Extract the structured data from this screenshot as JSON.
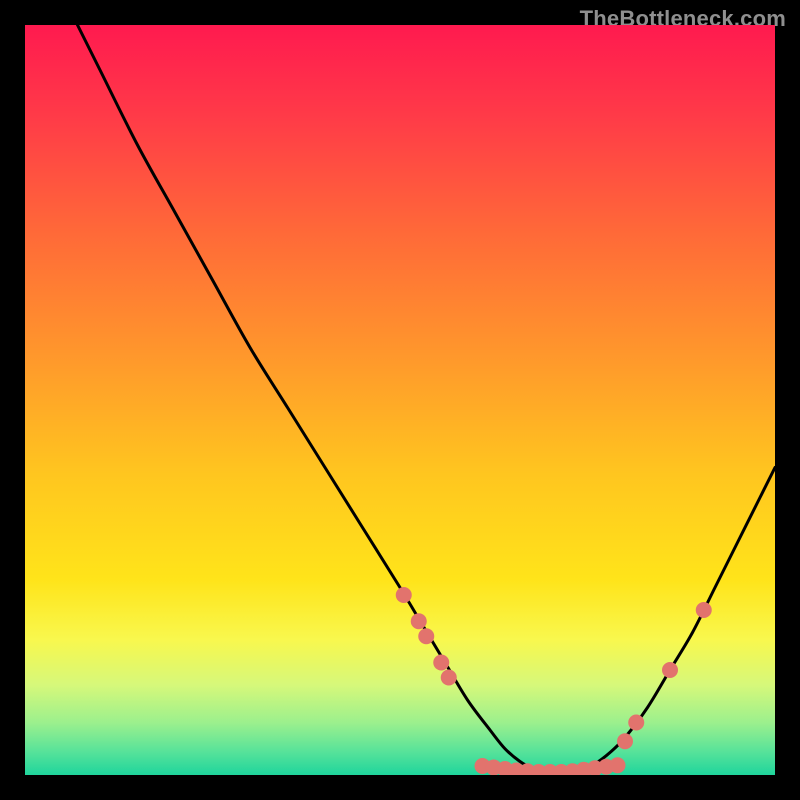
{
  "watermark": "TheBottleneck.com",
  "chart_data": {
    "type": "line",
    "title": "",
    "xlabel": "",
    "ylabel": "",
    "xlim": [
      0,
      100
    ],
    "ylim": [
      0,
      100
    ],
    "series": [
      {
        "name": "bottleneck-curve",
        "color": "#000000",
        "x": [
          7,
          10,
          15,
          20,
          25,
          30,
          35,
          40,
          45,
          50,
          53,
          56,
          59,
          62,
          64,
          66,
          68,
          70,
          72,
          74,
          76,
          78,
          80,
          83,
          86,
          89,
          92,
          95,
          98,
          100
        ],
        "y": [
          100,
          94,
          84,
          75,
          66,
          57,
          49,
          41,
          33,
          25,
          20,
          15,
          10,
          6,
          3.5,
          1.8,
          0.7,
          0.2,
          0.2,
          0.6,
          1.5,
          3,
          5,
          9,
          14,
          19,
          25,
          31,
          37,
          41
        ]
      }
    ],
    "markers": {
      "color": "#e2736d",
      "radius": 8,
      "points": [
        {
          "x": 50.5,
          "y": 24
        },
        {
          "x": 52.5,
          "y": 20.5
        },
        {
          "x": 53.5,
          "y": 18.5
        },
        {
          "x": 55.5,
          "y": 15
        },
        {
          "x": 56.5,
          "y": 13
        },
        {
          "x": 61,
          "y": 1.2
        },
        {
          "x": 62.5,
          "y": 1.0
        },
        {
          "x": 64,
          "y": 0.8
        },
        {
          "x": 65.5,
          "y": 0.6
        },
        {
          "x": 67,
          "y": 0.5
        },
        {
          "x": 68.5,
          "y": 0.4
        },
        {
          "x": 70,
          "y": 0.4
        },
        {
          "x": 71.5,
          "y": 0.4
        },
        {
          "x": 73,
          "y": 0.5
        },
        {
          "x": 74.5,
          "y": 0.7
        },
        {
          "x": 76,
          "y": 0.9
        },
        {
          "x": 77.5,
          "y": 1.1
        },
        {
          "x": 79,
          "y": 1.3
        },
        {
          "x": 80,
          "y": 4.5
        },
        {
          "x": 81.5,
          "y": 7
        },
        {
          "x": 86,
          "y": 14
        },
        {
          "x": 90.5,
          "y": 22
        }
      ]
    },
    "gradient_stops": [
      {
        "offset": 0.0,
        "color": "#ff1a4f"
      },
      {
        "offset": 0.12,
        "color": "#ff3a48"
      },
      {
        "offset": 0.28,
        "color": "#ff6a38"
      },
      {
        "offset": 0.45,
        "color": "#ff9a2b"
      },
      {
        "offset": 0.6,
        "color": "#ffc61f"
      },
      {
        "offset": 0.74,
        "color": "#ffe41a"
      },
      {
        "offset": 0.82,
        "color": "#f8f84e"
      },
      {
        "offset": 0.88,
        "color": "#d6f87a"
      },
      {
        "offset": 0.93,
        "color": "#9cf08d"
      },
      {
        "offset": 0.97,
        "color": "#55e29a"
      },
      {
        "offset": 1.0,
        "color": "#1fd59c"
      }
    ]
  }
}
